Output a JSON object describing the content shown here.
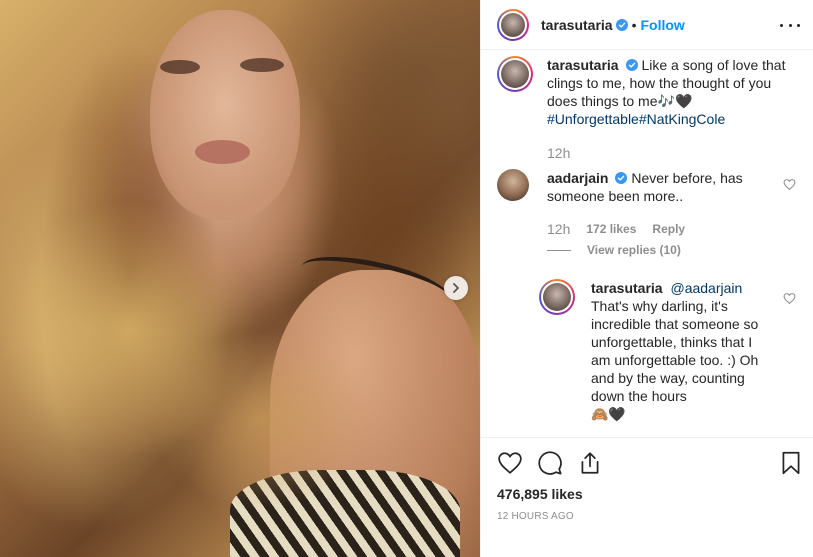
{
  "post": {
    "author": "tarasutaria",
    "follow_label": "Follow",
    "separator": "•"
  },
  "caption": {
    "username": "tarasutaria",
    "text": "Like a song of love that clings to me, how the thought of you does things to me",
    "emojis": "🎶🖤",
    "hashtags": "#Unforgettable#NatKingCole",
    "time": "12h"
  },
  "comments": [
    {
      "username": "aadarjain",
      "text": "Never before, has someone been more..",
      "time": "12h",
      "likes": "172 likes",
      "reply_label": "Reply",
      "view_replies": "View replies (10)"
    },
    {
      "username": "tarasutaria",
      "mention": "@aadarjain",
      "text": "That's why darling, it's incredible that someone so unforgettable, thinks that I am unforgettable too. :) Oh and by the way, counting down the hours",
      "emojis": "🙈🖤"
    }
  ],
  "footer": {
    "likes": "476,895 likes",
    "timestamp": "12 HOURS AGO"
  },
  "icons": {
    "verified": "verified-badge-icon",
    "more": "more-options-icon",
    "next": "chevron-right-icon",
    "heart": "heart-icon",
    "comment": "comment-icon",
    "share": "share-icon",
    "save": "bookmark-icon"
  },
  "colors": {
    "link": "#0095f6",
    "hashtag": "#00376b",
    "verified": "#3897f0",
    "muted": "#8e8e8e"
  }
}
